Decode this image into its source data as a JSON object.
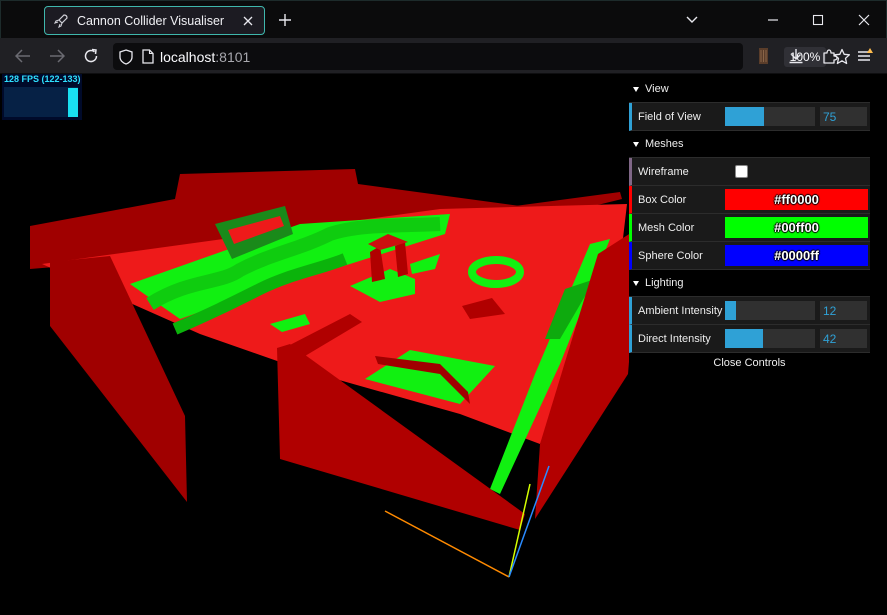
{
  "browser": {
    "tab_title": "Cannon Collider Visualiser",
    "url_host": "localhost",
    "url_port": ":8101",
    "zoom_level": "100%"
  },
  "stats": {
    "fps_text": "128 FPS (122-133)",
    "fps_current": 128,
    "fps_min": 122,
    "fps_max": 133
  },
  "gui": {
    "folders": {
      "view": "View",
      "meshes": "Meshes",
      "lighting": "Lighting"
    },
    "field_of_view": {
      "label": "Field of View",
      "value": "75"
    },
    "wireframe": {
      "label": "Wireframe",
      "checked": false
    },
    "box_color": {
      "label": "Box Color",
      "value": "#ff0000"
    },
    "mesh_color": {
      "label": "Mesh Color",
      "value": "#00ff00"
    },
    "sphere_color": {
      "label": "Sphere Color",
      "value": "#0000ff"
    },
    "ambient_intensity": {
      "label": "Ambient Intensity",
      "value": "12"
    },
    "direct_intensity": {
      "label": "Direct Intensity",
      "value": "42"
    },
    "close_label": "Close Controls"
  },
  "colors": {
    "accent": "#2fa1d6",
    "box": "#ff0000",
    "mesh": "#00ff00",
    "sphere": "#0000ff",
    "tab_border": "#3fb7ad"
  }
}
